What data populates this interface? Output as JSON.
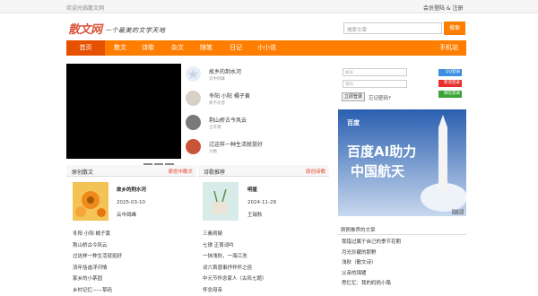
{
  "topbar": {
    "welcome": "欢迎光临散文网",
    "login": "会员登陆 & 注册"
  },
  "logo": {
    "name": "散文网",
    "slogan": "一个最美的文学天地"
  },
  "search": {
    "placeholder": "搜索文章",
    "button": "搜索"
  },
  "nav": [
    "首页",
    "散文",
    "诗歌",
    "杂文",
    "随笔",
    "日记",
    "小小说",
    "手机站"
  ],
  "hot_articles": [
    {
      "title": "故乡的荆水河",
      "author": "云中鸽峰"
    },
    {
      "title": "冬阳 小阳 橘子黄",
      "author": "蔡不乐雪"
    },
    {
      "title": "荆山桥古今风云",
      "author": "王丰锡"
    },
    {
      "title": "过这样一种生活就挺好",
      "author": "大鹏"
    }
  ],
  "recommend_prose": {
    "title": "原创散文",
    "more": "原创中散文",
    "featured": {
      "title": "故乡的荆水河",
      "date": "2025-03-10",
      "author": "云中鸽峰"
    },
    "list": [
      "冬阳 小阳 橘子黄",
      "荆山桥古今风云",
      "过这样一种生活就挺好",
      "流年恬谧浮河情",
      "家乡的小茅园",
      "乡村记忆——草码"
    ]
  },
  "recommend_poem": {
    "title": "诗歌推荐",
    "more": "原创诗歌",
    "featured": {
      "title": "明星",
      "date": "2024-11-28",
      "author": "王瑞秋"
    },
    "list": [
      "三素闹疑",
      "七律 正首词吟",
      "一抹浅秋，一海江洗",
      "词六首感事抒怀怀之倍",
      "中元节怀念家人（古风七题）",
      "怀念母亲"
    ]
  },
  "login_box": {
    "user_placeholder": "帐号",
    "pass_placeholder": "密码",
    "login_button": "立即登录",
    "forgot": "忘记密码?",
    "qq": "QQ登录",
    "weibo": "新浪登录",
    "wechat": "微信登录"
  },
  "ad": {
    "brand": "百度",
    "line1": "百度AI助力",
    "line2": "中国航天",
    "tag": "广告"
  },
  "side": {
    "title": "刚刚推荐的文章",
    "list": [
      "我错过属于自己的季节花期",
      "月光珍藏的那野",
      "浅秋（散文诗）",
      "父亲的锦猪",
      "思忆忆：我的妈妈小路"
    ]
  },
  "colors": {
    "accent": "#ff7e00",
    "nav_active": "#e65100",
    "more": "#e63c22"
  }
}
